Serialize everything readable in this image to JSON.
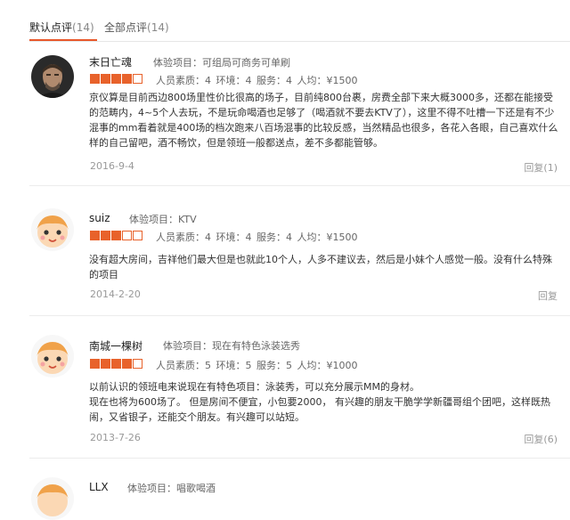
{
  "tabs": [
    {
      "label": "默认点评",
      "count": "(14)"
    },
    {
      "label": "全部点评",
      "count": "(14)"
    }
  ],
  "reviews": [
    {
      "name": "末日亡魂",
      "experience": "体验项目：可组局可商务可单刷",
      "stars": 4,
      "scores": "人员素质：4  环境：4  服务：4    人均：¥1500",
      "text": "京仪算是目前西边800场里性价比很高的场子，目前纯800台裹，房费全部下来大概3000多，还都在能接受的范畴内，4~5个人去玩，不是玩命喝酒也足够了（喝酒就不要去KTV了），这里不得不吐槽一下还是有不少混事的mm看着就是400场的档次跑来八百场混事的比较反感，当然精品也很多，各花入各眼，自己喜欢什么样的自己留吧，酒不畅饮，但是领班一般都送点，差不多都能管够。",
      "date": "2016-9-4",
      "reply": "回复(1)",
      "avatar": "man-photo"
    },
    {
      "name": "suiz",
      "experience": "体验项目：KTV",
      "stars": 3,
      "scores": "人员素质：4  环境：4  服务：4    人均：¥1500",
      "text": "没有超大房间，吉祥他们最大但是也就此10个人，人多不建议去，然后是小妹个人感觉一般。没有什么特殊的项目",
      "date": "2014-2-20",
      "reply": "回复",
      "avatar": "cartoon-default"
    },
    {
      "name": "南城一棵树",
      "experience": "体验项目：现在有特色泳装选秀",
      "stars": 4,
      "scores": "人员素质：5  环境：5  服务：5    人均：¥1000",
      "text": "以前认识的领班电来说现在有特色项目：泳装秀，可以充分展示MM的身材。\n现在也将为600场了。   但是房间不便宜，小包要2000，   有兴趣的朋友干脆学学新疆哥组个团吧，这样既热闹，又省银子，还能交个朋友。有兴趣可以站短。",
      "date": "2013-7-26",
      "reply": "回复(6)",
      "avatar": "cartoon-default"
    },
    {
      "name": "LLX",
      "experience": "体验项目：唱歌喝酒",
      "avatar": "cartoon-default"
    }
  ]
}
